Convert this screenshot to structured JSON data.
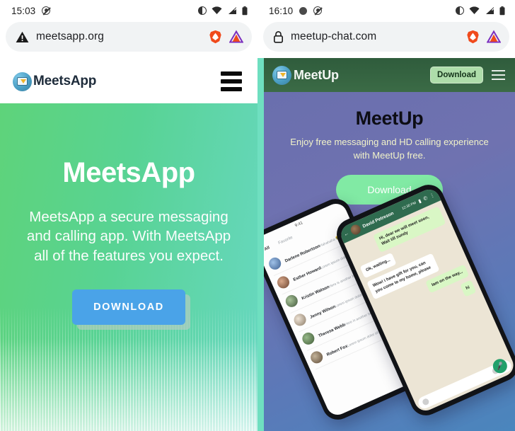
{
  "left": {
    "status": {
      "time": "15:03",
      "icons": [
        "contrast-icon",
        "wifi-icon",
        "signal-icon",
        "battery-icon"
      ]
    },
    "urlbar": {
      "security_icon": "warning-triangle-icon",
      "url": "meetsapp.org",
      "brave_icon": "brave-lion-icon",
      "rewards_icon": "brave-triangle-icon"
    },
    "header": {
      "brand": "MeetsApp",
      "logo_icon": "meetsapp-logo-icon",
      "menu_icon": "hamburger-icon"
    },
    "hero": {
      "title": "MeetsApp",
      "subtitle": "MeetsApp a secure messaging and calling app. With MeetsApp all of the features you expect.",
      "cta": "DOWNLOAD",
      "cta_color": "#4aa3e8",
      "gradient_from": "#5ed37a",
      "gradient_to": "#68d8c2"
    }
  },
  "right": {
    "status": {
      "time": "16:10",
      "icons": [
        "dot-icon",
        "contrast-icon",
        "wifi-icon",
        "signal-icon",
        "battery-icon"
      ]
    },
    "urlbar": {
      "security_icon": "lock-icon",
      "url": "meetup-chat.com",
      "brave_icon": "brave-lion-icon",
      "rewards_icon": "brave-triangle-icon"
    },
    "header": {
      "brand": "MeetUp",
      "logo_icon": "meetup-logo-icon",
      "download_label": "Download",
      "menu_icon": "hamburger-icon",
      "bg_color": "#32603f",
      "accent_color": "#6fdfc0"
    },
    "hero": {
      "title": "MeetUp",
      "subtitle": "Enjoy free messaging and HD calling experience with MeetUp free.",
      "cta": "Download",
      "cta_color": "#81eaa4",
      "gradient_from": "#6a6fae",
      "gradient_to": "#4a86bd"
    },
    "phone_left": {
      "time": "9:41",
      "tabs": [
        "All",
        "Favorite"
      ],
      "contacts": [
        {
          "name": "Darlene Robertson",
          "message": "Hahahaha 😂😂"
        },
        {
          "name": "Esther Howard",
          "message": "Lorem ipsum dolor sit amet"
        },
        {
          "name": "Kristin Watson",
          "message": "Here is another beautiful"
        },
        {
          "name": "Jenny Wilson",
          "message": "Lorem ipsum dolor sit amet"
        },
        {
          "name": "Theresa Webb",
          "message": "Here is another beautiful"
        },
        {
          "name": "Robert Fox",
          "message": "Lorem ipsum dolor sit amet, cons"
        }
      ]
    },
    "phone_right": {
      "contact": "David Petreson",
      "time": "12:30 PM",
      "back_icon": "back-arrow-icon",
      "video_icon": "video-call-icon",
      "call_icon": "phone-call-icon",
      "more_icon": "more-vertical-icon",
      "mic_icon": "mic-icon",
      "messages": [
        {
          "from": "out",
          "text": "Hi, dear we will meet soon, Wait till sundy"
        },
        {
          "from": "in",
          "text": "Ok, waiting..."
        },
        {
          "from": "in",
          "text": "Wow! i have gift for you, can you come to my home, please"
        },
        {
          "from": "out",
          "text": "Iam on the way..."
        },
        {
          "from": "out",
          "text": "hi"
        }
      ]
    }
  }
}
